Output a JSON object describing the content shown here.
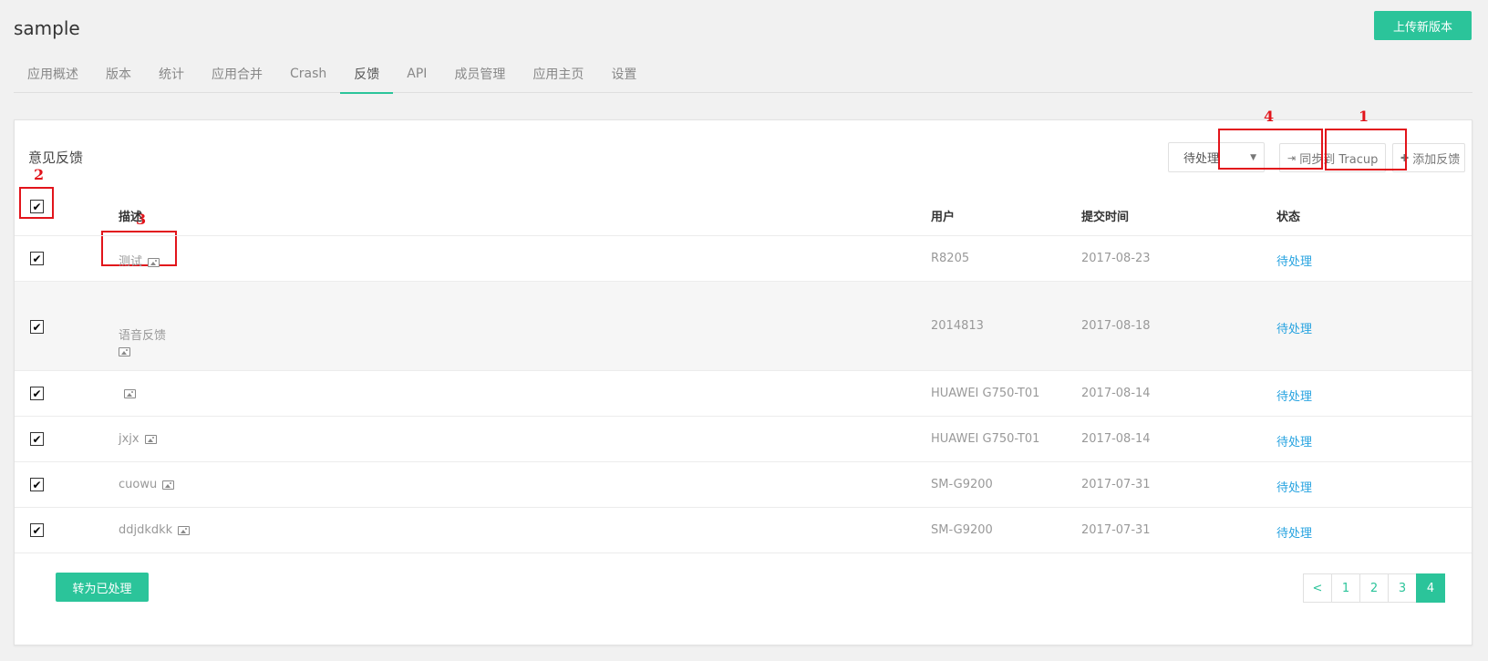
{
  "app": {
    "title": "sample",
    "upload_label": "上传新版本"
  },
  "tabs": [
    {
      "label": "应用概述"
    },
    {
      "label": "版本"
    },
    {
      "label": "统计"
    },
    {
      "label": "应用合并"
    },
    {
      "label": "Crash"
    },
    {
      "label": "反馈",
      "active": true
    },
    {
      "label": "API"
    },
    {
      "label": "成员管理"
    },
    {
      "label": "应用主页"
    },
    {
      "label": "设置"
    }
  ],
  "panel": {
    "title": "意见反馈",
    "status_filter": "待处理",
    "sync_label": "同步到 Tracup",
    "add_label": "添加反馈"
  },
  "annotations": [
    "1",
    "2",
    "3",
    "4"
  ],
  "table": {
    "headers": {
      "description": "描述",
      "user": "用户",
      "time": "提交时间",
      "status": "状态"
    },
    "rows": [
      {
        "description": "测试",
        "user": "R8205",
        "time": "2017-08-23",
        "status": "待处理"
      },
      {
        "description": "语音反馈",
        "user": "2014813",
        "time": "2017-08-18",
        "status": "待处理"
      },
      {
        "description": "",
        "user": "HUAWEI G750-T01",
        "time": "2017-08-14",
        "status": "待处理"
      },
      {
        "description": "jxjx",
        "user": "HUAWEI G750-T01",
        "time": "2017-08-14",
        "status": "待处理"
      },
      {
        "description": "cuowu",
        "user": "SM-G9200",
        "time": "2017-07-31",
        "status": "待处理"
      },
      {
        "description": "ddjdkdkk",
        "user": "SM-G9200",
        "time": "2017-07-31",
        "status": "待处理"
      }
    ]
  },
  "footer": {
    "process_label": "转为已处理",
    "pager": {
      "prev": "<",
      "pages": [
        "1",
        "2",
        "3",
        "4"
      ],
      "current": "4"
    }
  },
  "colors": {
    "accent": "#2bc49a",
    "link": "#27a3e0",
    "annotation": "#e2141b"
  }
}
